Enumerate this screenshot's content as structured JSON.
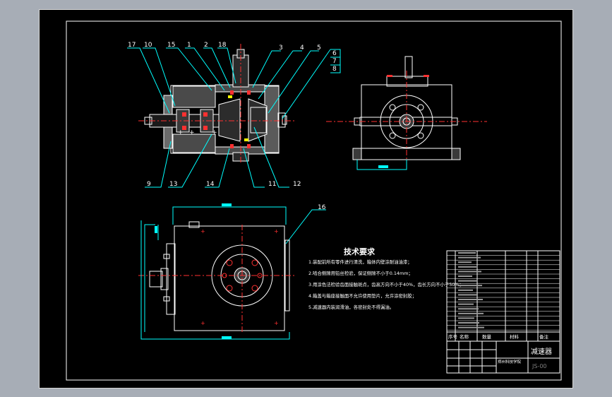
{
  "drawing": {
    "leaders": [
      "17",
      "10",
      "15",
      "1",
      "2",
      "18",
      "3",
      "4",
      "5",
      "6",
      "7",
      "8",
      "9",
      "13",
      "14",
      "11",
      "12",
      "16"
    ],
    "tech_title": "技术要求",
    "tech_lines": [
      "1.装配前所有零件进行清洗，箱体内壁涂耐油油漆；",
      "2.啮合侧隙用铅丝检验，保证侧隙不小于0.14mm；",
      "3.用涂色法检验齿面接触斑点，齿高方向不小于40%，齿长方向不小于50%；",
      "4.箱盖与箱座接触面不允许使用垫片，允许涂密封胶；",
      "5.减速器内装润滑油，各密封处不得漏油。"
    ],
    "title_block": {
      "name": "减速器",
      "drawing_no": "JS-00",
      "school": "郑州科技学院",
      "header": [
        "序号",
        "名称",
        "数量",
        "材料",
        "备注"
      ]
    }
  },
  "colors": {
    "background": "#a7adb6",
    "paper": "#000000",
    "line": "#ffffff",
    "dim": "#00ffff",
    "center": "#ff3030",
    "accent": "#ffff00",
    "text": "#ffffff"
  }
}
